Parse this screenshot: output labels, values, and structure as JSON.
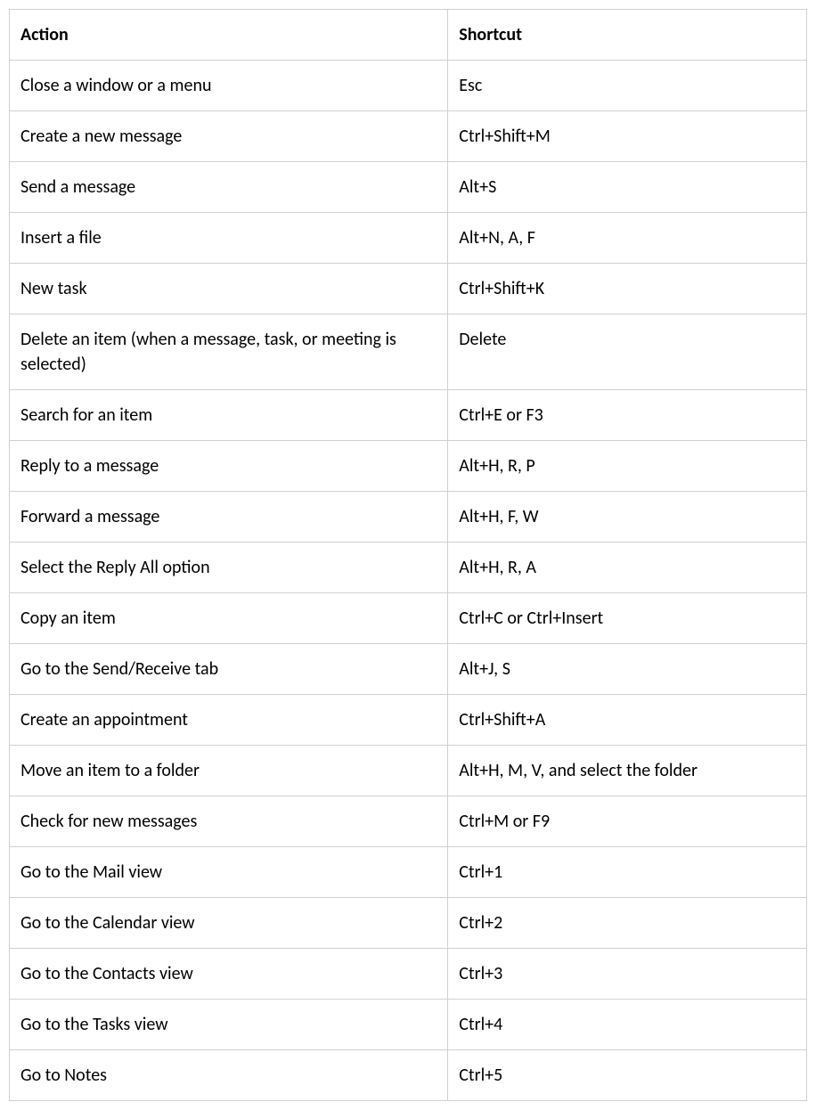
{
  "table": {
    "headers": {
      "action": "Action",
      "shortcut": "Shortcut"
    },
    "rows": [
      {
        "action": "Close a window or a menu",
        "shortcut": "Esc"
      },
      {
        "action": "Create a new message",
        "shortcut": "Ctrl+Shift+M"
      },
      {
        "action": "Send a message",
        "shortcut": "Alt+S"
      },
      {
        "action": "Insert a file",
        "shortcut": "Alt+N, A, F"
      },
      {
        "action": "New task",
        "shortcut": "Ctrl+Shift+K"
      },
      {
        "action": "Delete an item (when a message, task, or meeting is selected)",
        "shortcut": "Delete"
      },
      {
        "action": "Search for an item",
        "shortcut": "Ctrl+E or F3"
      },
      {
        "action": "Reply to a message",
        "shortcut": "Alt+H, R, P"
      },
      {
        "action": "Forward a message",
        "shortcut": "Alt+H, F, W"
      },
      {
        "action": "Select the Reply All option",
        "shortcut": "Alt+H, R, A"
      },
      {
        "action": "Copy an item",
        "shortcut": "Ctrl+C or Ctrl+Insert"
      },
      {
        "action": "Go to the Send/Receive tab",
        "shortcut": "Alt+J, S"
      },
      {
        "action": "Create an appointment",
        "shortcut": "Ctrl+Shift+A"
      },
      {
        "action": "Move an item to a folder",
        "shortcut": "Alt+H, M, V, and select the folder"
      },
      {
        "action": "Check for new messages",
        "shortcut": "Ctrl+M or F9"
      },
      {
        "action": "Go to the Mail view",
        "shortcut": "Ctrl+1"
      },
      {
        "action": "Go to the Calendar view",
        "shortcut": "Ctrl+2"
      },
      {
        "action": "Go to the Contacts view",
        "shortcut": "Ctrl+3"
      },
      {
        "action": "Go to the Tasks view",
        "shortcut": "Ctrl+4"
      },
      {
        "action": "Go to Notes",
        "shortcut": "Ctrl+5"
      }
    ]
  }
}
